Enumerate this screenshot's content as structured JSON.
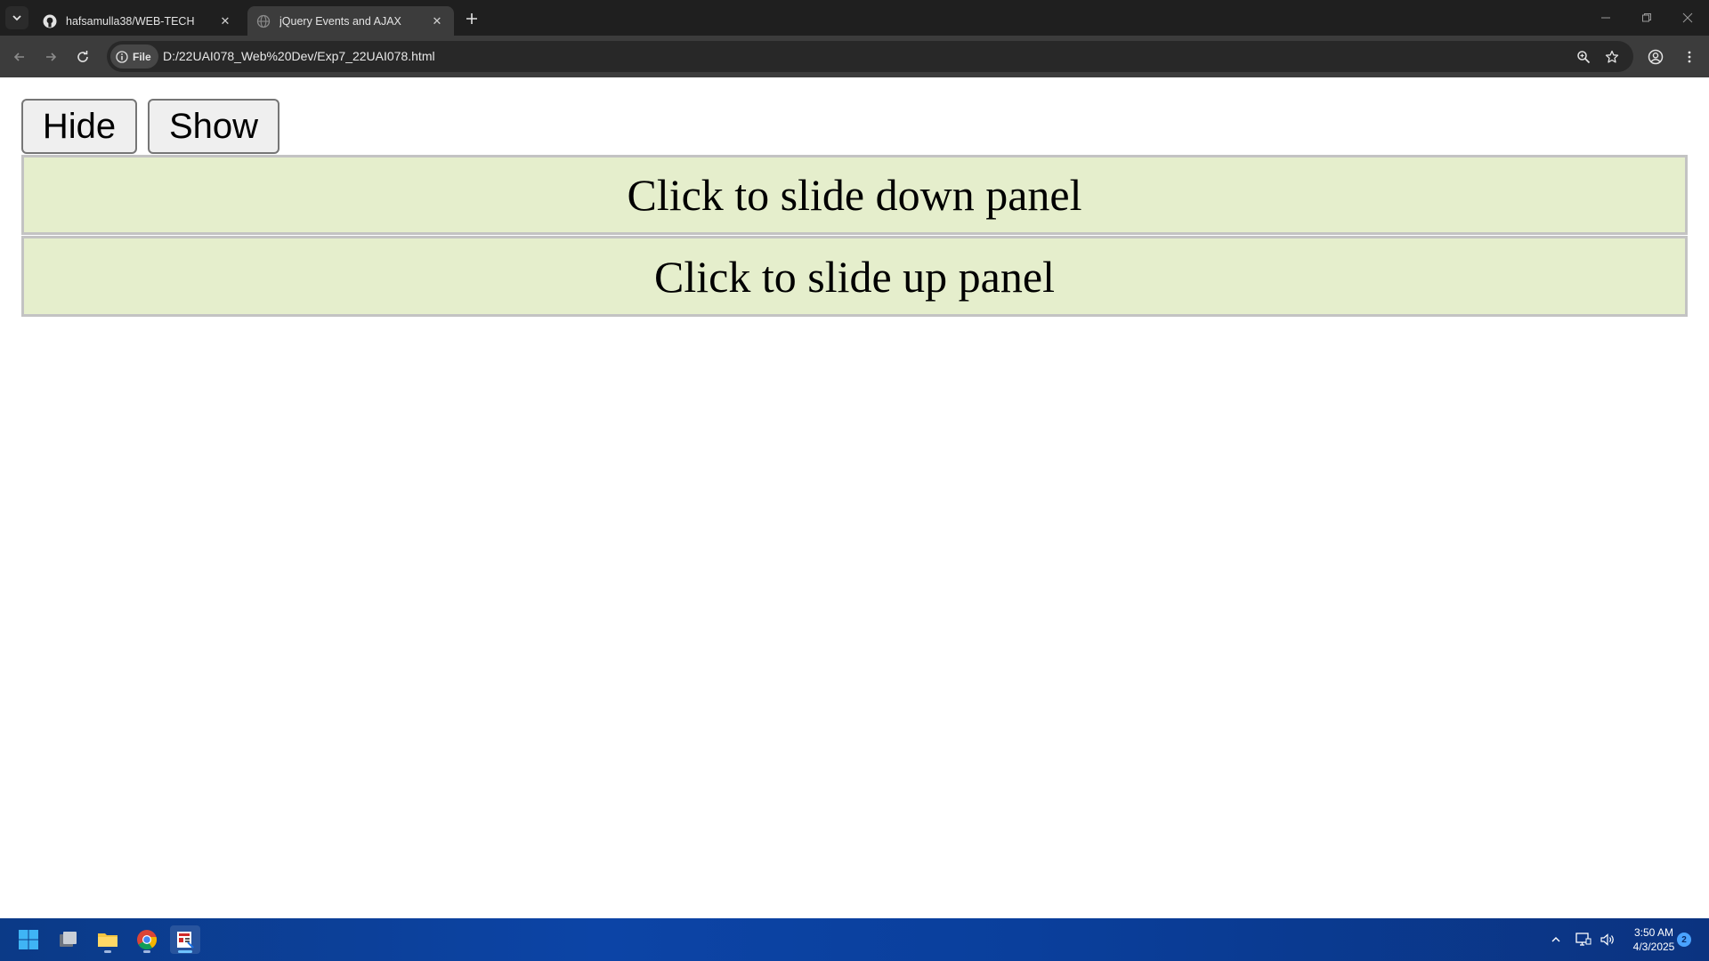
{
  "browser": {
    "tabs": [
      {
        "title": "hafsamulla38/WEB-TECH",
        "favicon": "github-icon",
        "active": false
      },
      {
        "title": "jQuery Events and AJAX",
        "favicon": "globe-icon",
        "active": true
      }
    ],
    "address": {
      "chip_label": "File",
      "url": "D:/22UAI078_Web%20Dev/Exp7_22UAI078.html"
    }
  },
  "page": {
    "buttons": {
      "hide_label": "Hide",
      "show_label": "Show"
    },
    "panels": {
      "slide_down_text": "Click to slide down panel",
      "slide_up_text": "Click to slide up panel"
    },
    "colors": {
      "panel_background": "#e5eecc",
      "panel_border": "#c3c3c3"
    }
  },
  "taskbar": {
    "time": "3:50 AM",
    "date": "4/3/2025",
    "notification_count": "2"
  }
}
